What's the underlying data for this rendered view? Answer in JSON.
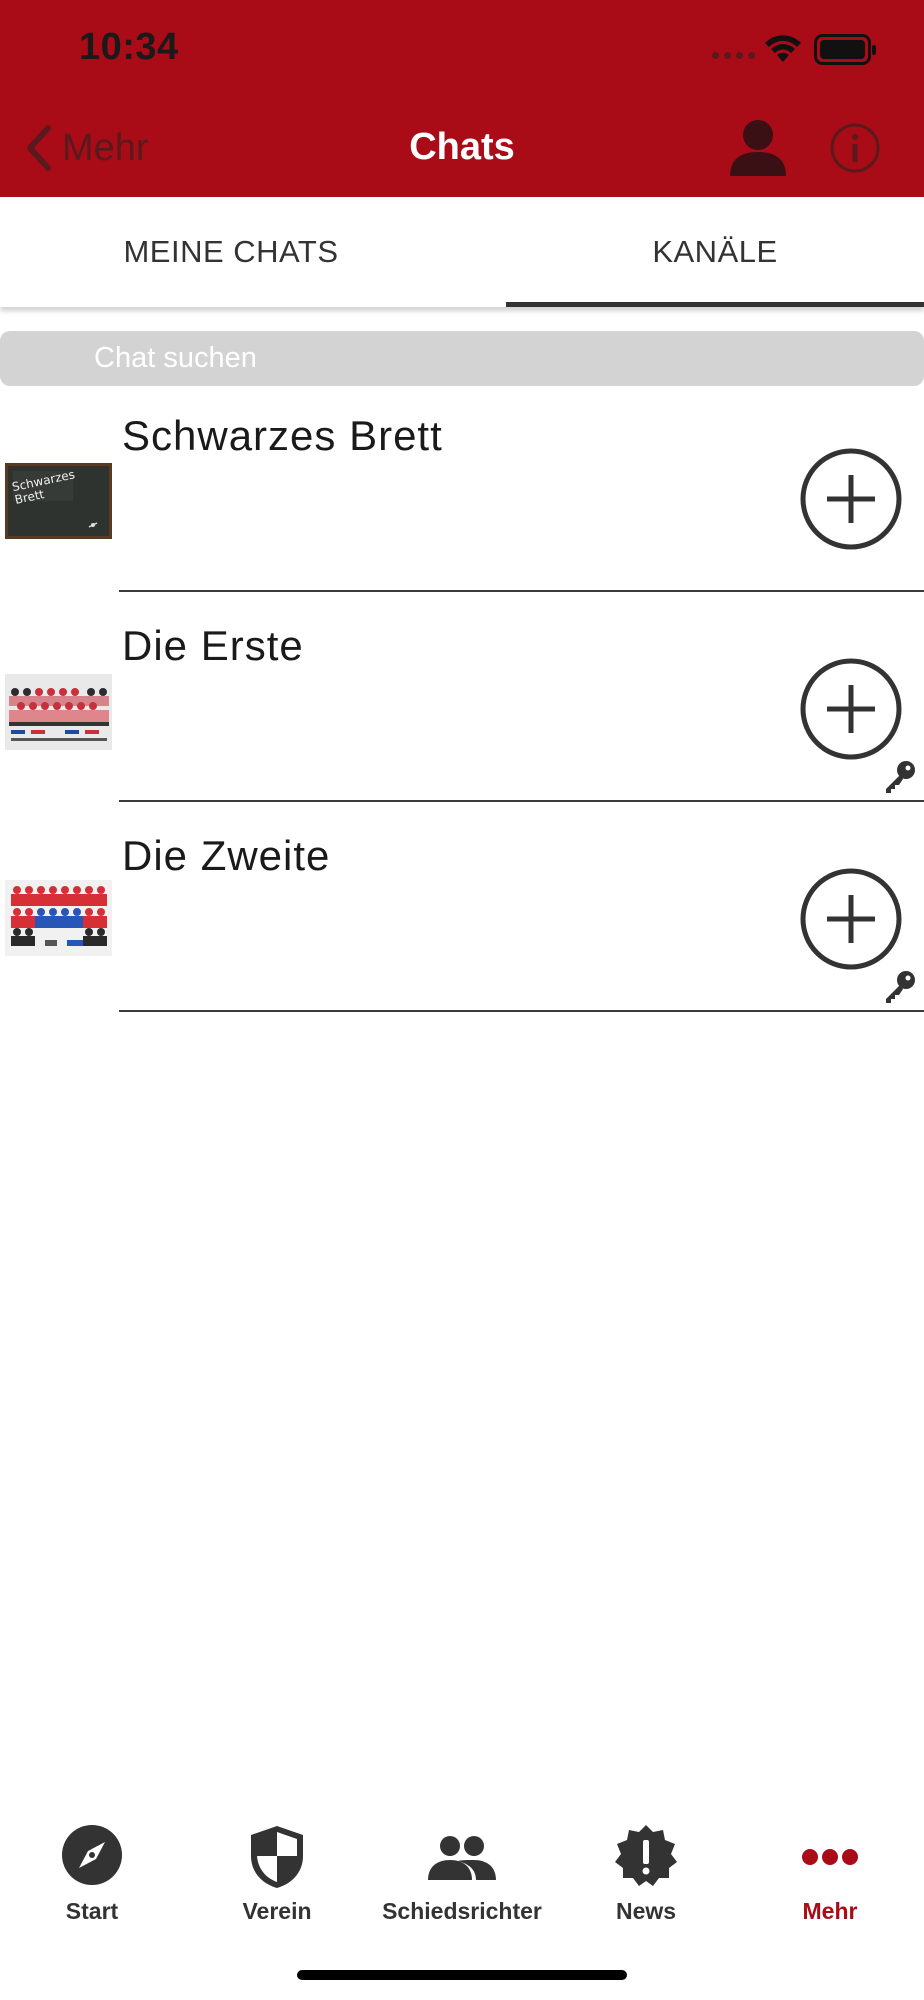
{
  "status_bar": {
    "time": "10:34"
  },
  "nav": {
    "back_label": "Mehr",
    "title": "Chats"
  },
  "tabs": [
    {
      "label": "MEINE CHATS",
      "active": false
    },
    {
      "label": "KANÄLE",
      "active": true
    }
  ],
  "search": {
    "placeholder": "Chat suchen",
    "value": ""
  },
  "channels": [
    {
      "name": "Schwarzes Brett",
      "thumbnail_text": "Schwarzes Brett",
      "icon": "plus-circle-icon",
      "locked": false
    },
    {
      "name": "Die Erste",
      "icon": "plus-circle-icon",
      "locked": true
    },
    {
      "name": "Die Zweite",
      "icon": "plus-circle-icon",
      "locked": true
    }
  ],
  "tabbar": [
    {
      "label": "Start",
      "icon": "compass-icon",
      "active": false
    },
    {
      "label": "Verein",
      "icon": "shield-icon",
      "active": false
    },
    {
      "label": "Schiedsrichter",
      "icon": "people-icon",
      "active": false
    },
    {
      "label": "News",
      "icon": "alert-badge-icon",
      "active": false
    },
    {
      "label": "Mehr",
      "icon": "more-dots-icon",
      "active": true
    }
  ],
  "colors": {
    "brand_red": "#a90b17",
    "nav_dark_text": "#5a1a1d",
    "search_bg": "#d3d3d3",
    "text_dark": "#333333"
  }
}
